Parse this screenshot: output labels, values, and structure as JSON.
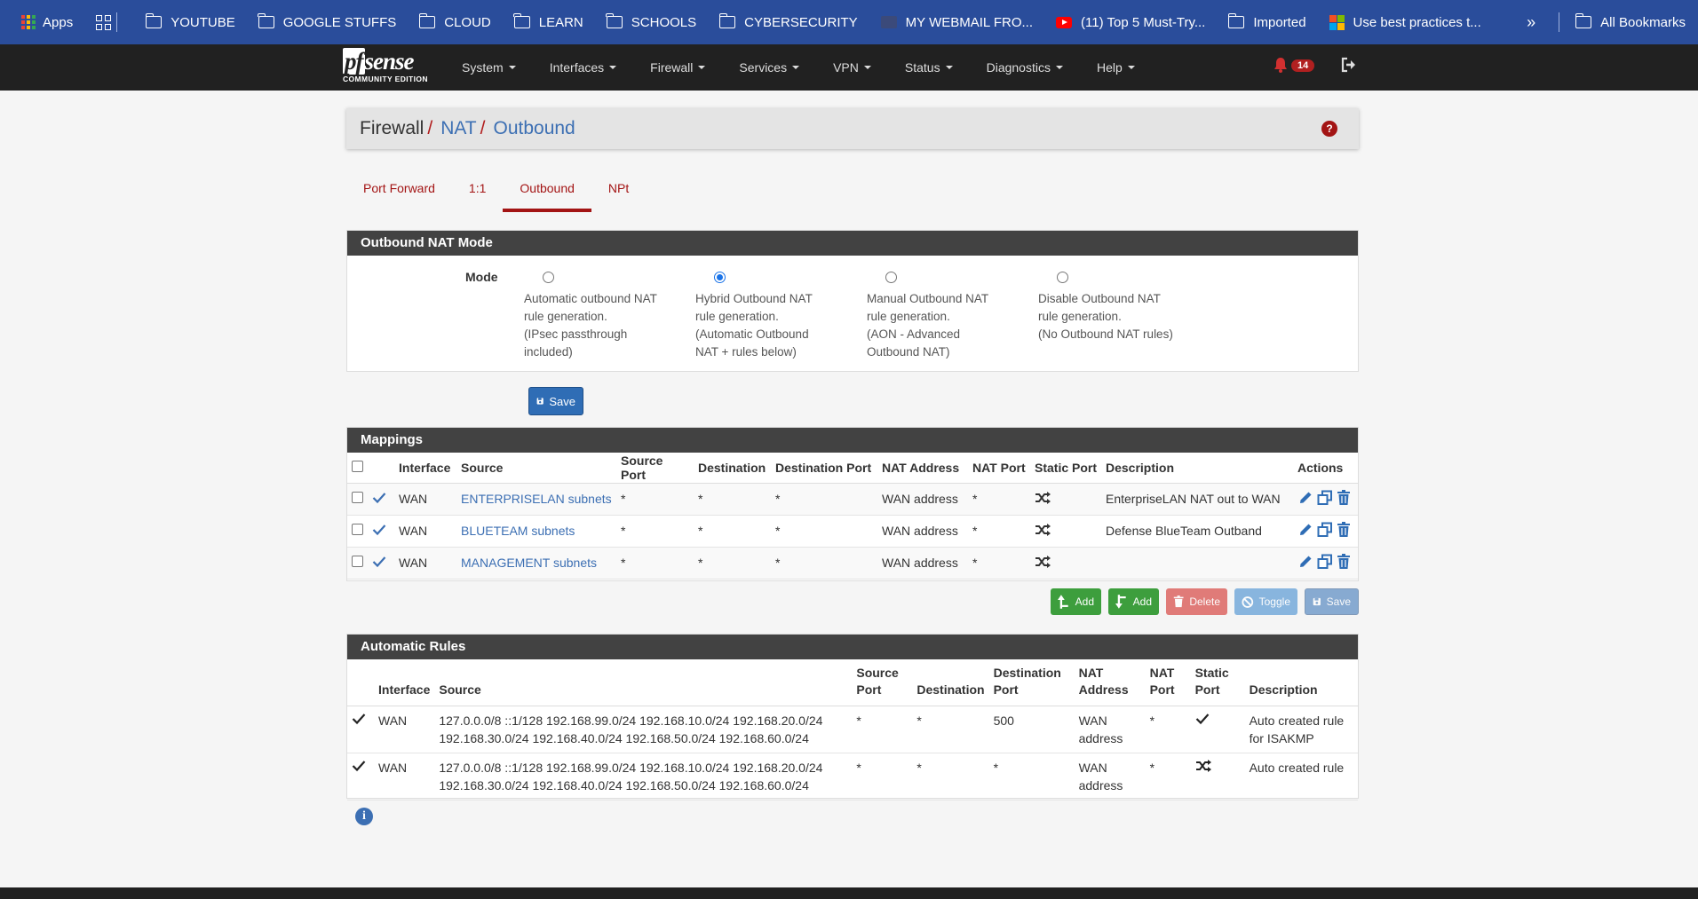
{
  "bookmarks": {
    "items": [
      "Apps",
      "YOUTUBE",
      "GOOGLE STUFFS",
      "CLOUD",
      "LEARN",
      "SCHOOLS",
      "CYBERSECURITY",
      "MY WEBMAIL FRO...",
      "(11) Top 5 Must-Try...",
      "Imported",
      "Use best practices t..."
    ],
    "all_bookmarks": "All Bookmarks"
  },
  "navbar": {
    "logo_pf": "pf",
    "logo_sense": "sense",
    "edition": "COMMUNITY EDITION",
    "menu": [
      "System",
      "Interfaces",
      "Firewall",
      "Services",
      "VPN",
      "Status",
      "Diagnostics",
      "Help"
    ],
    "notification_count": "14"
  },
  "breadcrumb": {
    "root": "Firewall",
    "sep": "/",
    "level1": "NAT",
    "level2": "Outbound",
    "help": "?"
  },
  "tabs": [
    "Port Forward",
    "1:1",
    "Outbound",
    "NPt"
  ],
  "mode_panel": {
    "title": "Outbound NAT Mode",
    "label": "Mode",
    "options": [
      {
        "lines": [
          "Automatic outbound NAT",
          "rule generation.",
          "(IPsec passthrough",
          "included)"
        ]
      },
      {
        "lines": [
          "Hybrid Outbound NAT",
          "rule generation.",
          "(Automatic Outbound",
          "NAT + rules below)"
        ]
      },
      {
        "lines": [
          "Manual Outbound NAT",
          "rule generation.",
          "(AON - Advanced",
          "Outbound NAT)"
        ]
      },
      {
        "lines": [
          "Disable Outbound NAT",
          "rule generation.",
          "(No Outbound NAT rules)",
          ""
        ]
      }
    ],
    "selected_index": 1,
    "save_label": "Save"
  },
  "mappings": {
    "title": "Mappings",
    "headers": [
      "Interface",
      "Source",
      "Source Port",
      "Destination",
      "Destination Port",
      "NAT Address",
      "NAT Port",
      "Static Port",
      "Description",
      "Actions"
    ],
    "rows": [
      {
        "interface": "WAN",
        "source": "ENTERPRISELAN subnets",
        "source_port": "*",
        "destination": "*",
        "destination_port": "*",
        "nat_address": "WAN address",
        "nat_port": "*",
        "description": "EnterpriseLAN NAT out to WAN"
      },
      {
        "interface": "WAN",
        "source": "BLUETEAM subnets",
        "source_port": "*",
        "destination": "*",
        "destination_port": "*",
        "nat_address": "WAN address",
        "nat_port": "*",
        "description": "Defense BlueTeam Outband"
      },
      {
        "interface": "WAN",
        "source": "MANAGEMENT subnets",
        "source_port": "*",
        "destination": "*",
        "destination_port": "*",
        "nat_address": "WAN address",
        "nat_port": "*",
        "description": ""
      }
    ],
    "buttons": {
      "add_top": "Add",
      "add_bottom": "Add",
      "delete": "Delete",
      "toggle": "Toggle",
      "save": "Save"
    }
  },
  "automatic_rules": {
    "title": "Automatic Rules",
    "headers": {
      "interface": "Interface",
      "source": "Source",
      "source_port_1": "Source",
      "source_port_2": "Port",
      "destination": "Destination",
      "dest_port_1": "Destination",
      "dest_port_2": "Port",
      "nat_address_1": "NAT",
      "nat_address_2": "Address",
      "nat_port_1": "NAT",
      "nat_port_2": "Port",
      "static_port_1": "Static",
      "static_port_2": "Port",
      "description": "Description"
    },
    "rows": [
      {
        "interface": "WAN",
        "source_1": "127.0.0.0/8 ::1/128 192.168.99.0/24 192.168.10.0/24 192.168.20.0/24",
        "source_2": "192.168.30.0/24 192.168.40.0/24 192.168.50.0/24 192.168.60.0/24",
        "source_port": "*",
        "destination": "*",
        "destination_port": "500",
        "nat_address_1": "WAN",
        "nat_address_2": "address",
        "nat_port": "*",
        "description_1": "Auto created rule",
        "description_2": "for ISAKMP"
      },
      {
        "interface": "WAN",
        "source_1": "127.0.0.0/8 ::1/128 192.168.99.0/24 192.168.10.0/24 192.168.20.0/24",
        "source_2": "192.168.30.0/24 192.168.40.0/24 192.168.50.0/24 192.168.60.0/24",
        "source_port": "*",
        "destination": "*",
        "destination_port": "*",
        "nat_address_1": "WAN",
        "nat_address_2": "address",
        "nat_port": "*",
        "description_1": "Auto created rule",
        "description_2": ""
      }
    ]
  },
  "colors": {
    "accent_red": "#a31414",
    "nav_dark": "#212121",
    "link_blue": "#3c6fb3",
    "bookmark_bar": "#2a4d9b"
  }
}
